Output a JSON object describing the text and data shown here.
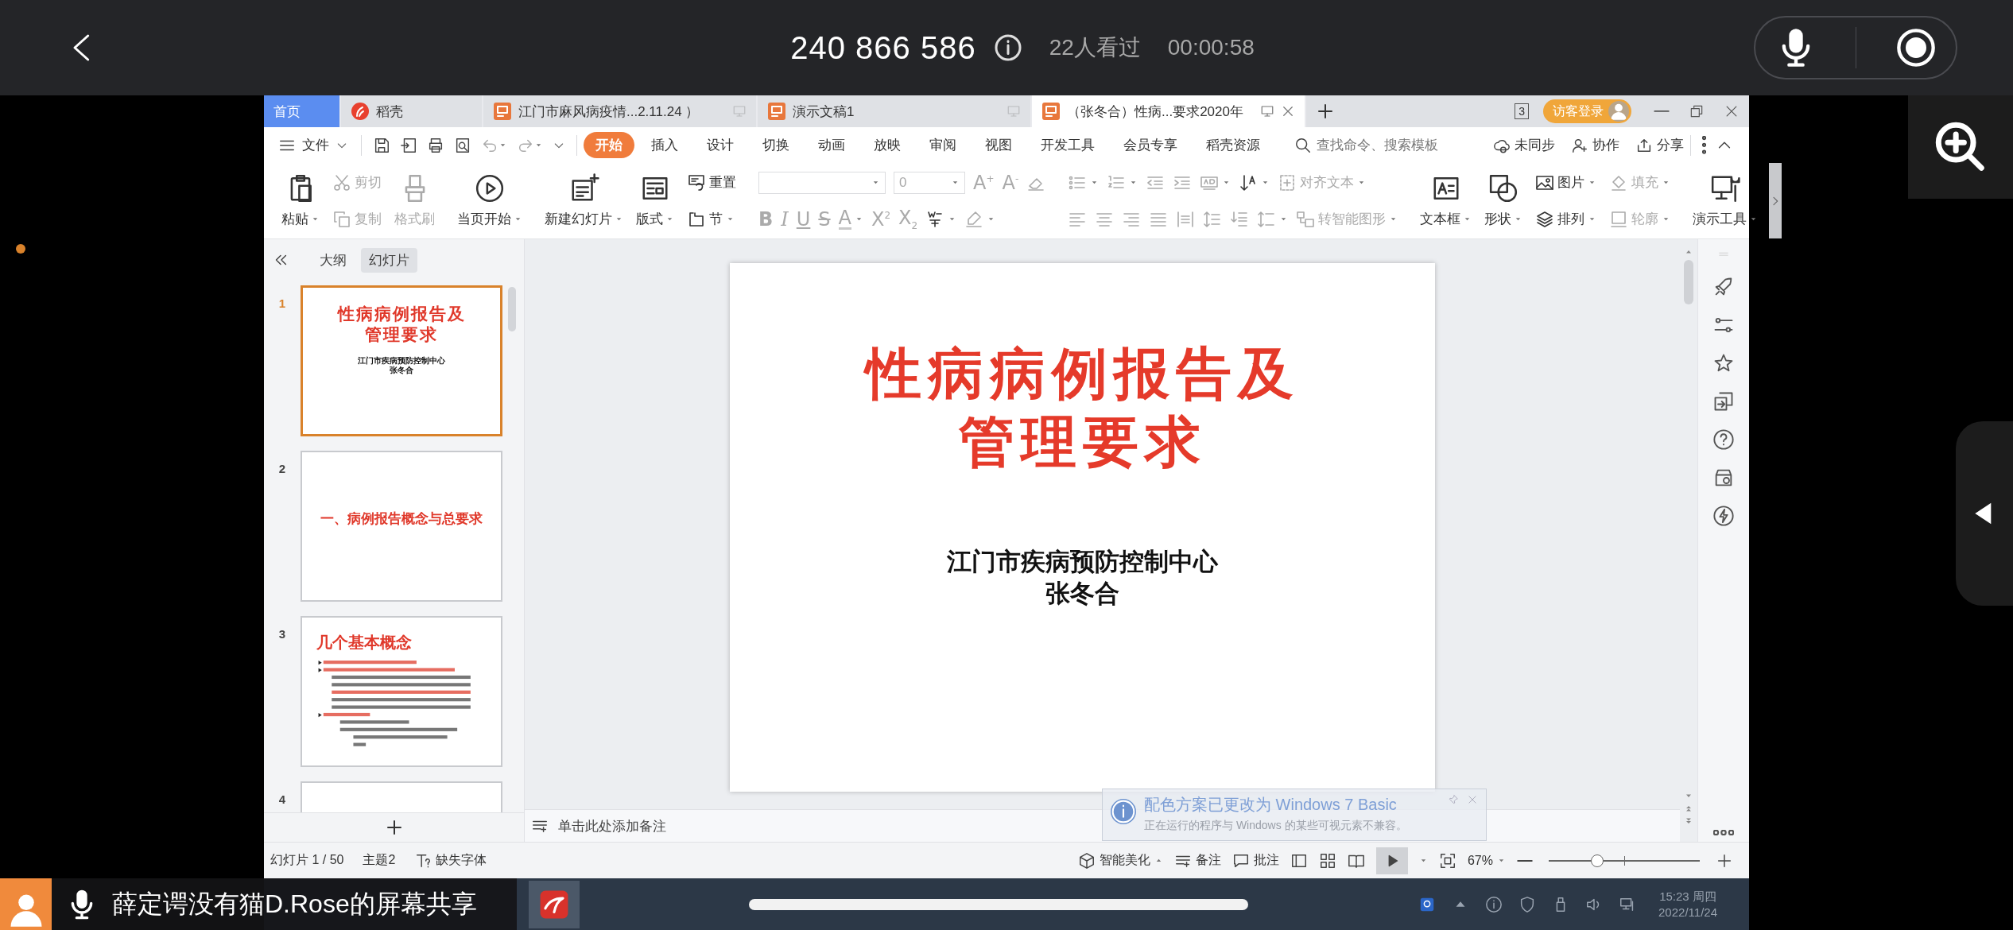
{
  "phone_bar": {
    "meeting_id": "240 866 586",
    "viewers": "22人看过",
    "elapsed": "00:00:58"
  },
  "window": {
    "tabs": [
      {
        "kind": "home",
        "label": "首页",
        "selected": false
      },
      {
        "kind": "docer",
        "label": "稻壳",
        "selected": false
      },
      {
        "kind": "presentation",
        "label": "江门市麻风病疫情...2.11.24 ）",
        "selected": false
      },
      {
        "kind": "presentation",
        "label": "演示文稿1",
        "selected": false
      },
      {
        "kind": "presentation",
        "label": "（张冬合）性病...要求2020年",
        "selected": true
      }
    ],
    "window_count": "3",
    "login": "访客登录"
  },
  "menu": {
    "file": "文件",
    "tabs": [
      {
        "label": "开始",
        "selected": true
      },
      {
        "label": "插入",
        "selected": false
      },
      {
        "label": "设计",
        "selected": false
      },
      {
        "label": "切换",
        "selected": false
      },
      {
        "label": "动画",
        "selected": false
      },
      {
        "label": "放映",
        "selected": false
      },
      {
        "label": "审阅",
        "selected": false
      },
      {
        "label": "视图",
        "selected": false
      },
      {
        "label": "开发工具",
        "selected": false
      },
      {
        "label": "会员专享",
        "selected": false
      },
      {
        "label": "稻壳资源",
        "selected": false
      }
    ],
    "search_placeholder": "查找命令、搜索模板",
    "actions": [
      {
        "kind": "sync",
        "label": "未同步"
      },
      {
        "kind": "collab",
        "label": "协作"
      },
      {
        "kind": "share",
        "label": "分享"
      }
    ]
  },
  "ribbon": [
    {
      "columns": [
        {
          "kind": "large",
          "item": {
            "kind": "paste",
            "label": "粘贴",
            "dropdown": true,
            "disabled": false
          }
        },
        {
          "kind": "stack",
          "lines": [
            {
              "items": [
                {
                  "kind": "cut",
                  "label": "剪切",
                  "disabled": true
                }
              ]
            },
            {
              "items": [
                {
                  "kind": "copy",
                  "label": "复制",
                  "disabled": true
                }
              ]
            }
          ]
        },
        {
          "kind": "large",
          "item": {
            "kind": "painter",
            "label": "格式刷",
            "disabled": true
          }
        }
      ]
    },
    {
      "columns": [
        {
          "kind": "large",
          "item": {
            "kind": "play",
            "label": "当页开始",
            "dropdown": true,
            "disabled": false
          }
        }
      ]
    },
    {
      "columns": [
        {
          "kind": "large",
          "item": {
            "kind": "newslide",
            "label": "新建幻灯片",
            "dropdown": true,
            "disabled": false
          }
        },
        {
          "kind": "large",
          "item": {
            "kind": "layout",
            "label": "版式",
            "dropdown": true,
            "disabled": false
          }
        },
        {
          "kind": "stack",
          "lines": [
            {
              "items": [
                {
                  "kind": "reset",
                  "label": "重置",
                  "disabled": false
                }
              ]
            },
            {
              "items": [
                {
                  "kind": "section",
                  "label": "节",
                  "dropdown": true,
                  "disabled": false
                }
              ]
            }
          ]
        }
      ]
    },
    {
      "columns": [
        {
          "kind": "stack",
          "lines": [
            {
              "items": [
                {
                  "kind": "fontname",
                  "dropdown": true,
                  "disabled": true
                },
                {
                  "kind": "fontsize",
                  "value": "0",
                  "dropdown": true,
                  "disabled": true
                },
                {
                  "kind": "grow",
                  "text": "A$^{+}$",
                  "disabled": true
                },
                {
                  "kind": "shrink",
                  "text": "A$^{-}$",
                  "disabled": true
                },
                {
                  "kind": "eraser",
                  "disabled": true
                }
              ]
            },
            {
              "items": [
                {
                  "kind": "bold",
                  "text": "B",
                  "disabled": true
                },
                {
                  "kind": "italic",
                  "text": "I",
                  "disabled": true
                },
                {
                  "kind": "underline",
                  "text": "U",
                  "disabled": true
                },
                {
                  "kind": "strike",
                  "text": "S",
                  "disabled": true
                },
                {
                  "kind": "fontcolor",
                  "text": "A",
                  "dropdown": true,
                  "disabled": true
                },
                {
                  "kind": "superscript",
                  "text": "X$^{2}$",
                  "disabled": true
                },
                {
                  "kind": "subscript",
                  "text": "X$_{2}$",
                  "disabled": true
                },
                {
                  "kind": "phonetic",
                  "dropdown": true,
                  "disabled": false
                },
                {
                  "kind": "highlight",
                  "dropdown": true,
                  "disabled": true
                }
              ]
            }
          ]
        }
      ]
    },
    {
      "columns": [
        {
          "kind": "stack",
          "lines": [
            {
              "items": [
                {
                  "kind": "bullets",
                  "dropdown": true,
                  "disabled": true
                },
                {
                  "kind": "numbering",
                  "dropdown": true,
                  "disabled": true
                },
                {
                  "kind": "outdent",
                  "disabled": true
                },
                {
                  "kind": "indent",
                  "disabled": true
                },
                {
                  "kind": "direction",
                  "dropdown": true,
                  "disabled": true
                },
                {
                  "kind": "sort",
                  "dropdown": true,
                  "disabled": false
                },
                {
                  "kind": "aligntext",
                  "label": "对齐文本",
                  "dropdown": true,
                  "disabled": true
                }
              ]
            },
            {
              "items": [
                {
                  "kind": "left",
                  "disabled": true
                },
                {
                  "kind": "center",
                  "disabled": true
                },
                {
                  "kind": "right",
                  "disabled": true
                },
                {
                  "kind": "justify",
                  "disabled": true
                },
                {
                  "kind": "distribute",
                  "disabled": true
                },
                {
                  "kind": "linespacing",
                  "disabled": true
                },
                {
                  "kind": "paraspacing",
                  "disabled": true
                },
                {
                  "kind": "spacing",
                  "dropdown": true,
                  "disabled": true
                },
                {
                  "kind": "smartart",
                  "label": "转智能图形",
                  "dropdown": true,
                  "disabled": true
                }
              ]
            }
          ]
        }
      ]
    },
    {
      "columns": [
        {
          "kind": "large",
          "item": {
            "kind": "textbox",
            "label": "文本框",
            "dropdown": true,
            "disabled": false
          }
        },
        {
          "kind": "large",
          "item": {
            "kind": "shape",
            "label": "形状",
            "dropdown": true,
            "disabled": false
          }
        },
        {
          "kind": "stack",
          "lines": [
            {
              "items": [
                {
                  "kind": "picture",
                  "label": "图片",
                  "dropdown": true,
                  "disabled": false
                }
              ]
            },
            {
              "items": [
                {
                  "kind": "arrange",
                  "label": "排列",
                  "dropdown": true,
                  "disabled": false
                }
              ]
            }
          ]
        },
        {
          "kind": "stack",
          "lines": [
            {
              "items": [
                {
                  "kind": "fill",
                  "label": "填充",
                  "dropdown": true,
                  "disabled": true
                }
              ]
            },
            {
              "items": [
                {
                  "kind": "outline",
                  "label": "轮廓",
                  "dropdown": true,
                  "disabled": true
                }
              ]
            }
          ]
        }
      ]
    },
    {
      "columns": [
        {
          "kind": "large",
          "item": {
            "kind": "tools",
            "label": "演示工具",
            "dropdown": true,
            "disabled": false
          }
        }
      ]
    }
  ],
  "outline_panel": {
    "tabs": [
      {
        "label": "大纲",
        "selected": false
      },
      {
        "label": "幻灯片",
        "selected": true
      }
    ],
    "slides": [
      {
        "number": "1",
        "selected": true,
        "kind": "title",
        "title_lines": [
          "性病病例报告及",
          "管理要求"
        ],
        "subtitle_lines": [
          "江门市疾病预防控制中心",
          "张冬合"
        ]
      },
      {
        "number": "2",
        "selected": false,
        "kind": "section",
        "title_lines": [
          "一、病例报告概念与总要求"
        ]
      },
      {
        "number": "3",
        "selected": false,
        "kind": "bullets",
        "title_lines": [
          "几个基本概念"
        ]
      },
      {
        "number": "4",
        "selected": false,
        "kind": "blank"
      }
    ]
  },
  "slide": {
    "title_lines": [
      "性病病例报告及",
      "管理要求"
    ],
    "subtitle_lines": [
      "江门市疾病预防控制中心",
      "张冬合"
    ]
  },
  "notes_placeholder": "单击此处添加备注",
  "status_bar": {
    "slide_position": "幻灯片 1 / 50",
    "theme": "主题2",
    "missing_fonts": "缺失字体",
    "beautify": "智能美化",
    "notes": "备注",
    "comments": "批注",
    "zoom": "67%",
    "zoom_slider": {
      "level": 0.32
    }
  },
  "notification": {
    "title": "配色方案已更改为 Windows 7 Basic",
    "body": "正在运行的程序与 Windows 的某些可视元素不兼容。"
  },
  "taskbar": {
    "time": "15:23 周四",
    "date": "2022/11/24"
  },
  "share_bar": {
    "label": "薛定谔没有猫D.Rose的屏幕共享"
  }
}
